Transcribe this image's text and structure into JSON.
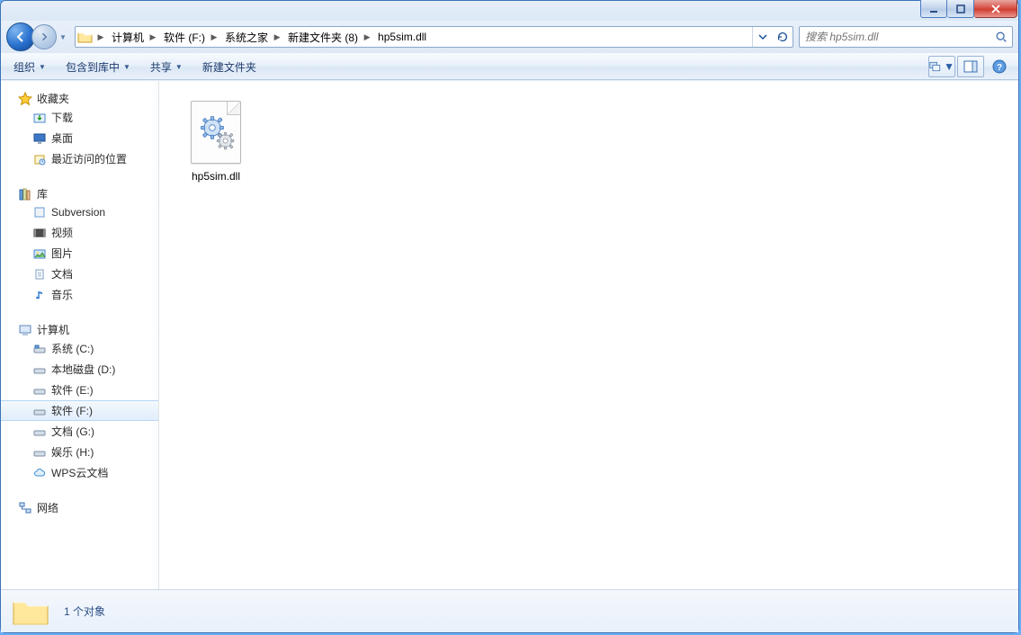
{
  "window_controls": {
    "minimize": "minimize",
    "maximize": "maximize",
    "close": "close"
  },
  "breadcrumb": {
    "items": [
      {
        "label": "计算机"
      },
      {
        "label": "软件 (F:)"
      },
      {
        "label": "系统之家"
      },
      {
        "label": "新建文件夹 (8)"
      },
      {
        "label": "hp5sim.dll"
      }
    ]
  },
  "search": {
    "placeholder": "搜索 hp5sim.dll"
  },
  "toolbar": {
    "organize": "组织",
    "include": "包含到库中",
    "share": "共享",
    "newfolder": "新建文件夹"
  },
  "sidebar": {
    "favorites": {
      "header": "收藏夹",
      "items": [
        {
          "label": "下载",
          "icon": "download-icon"
        },
        {
          "label": "桌面",
          "icon": "desktop-icon"
        },
        {
          "label": "最近访问的位置",
          "icon": "recent-icon"
        }
      ]
    },
    "libraries": {
      "header": "库",
      "items": [
        {
          "label": "Subversion",
          "icon": "library-generic-icon"
        },
        {
          "label": "视频",
          "icon": "video-icon"
        },
        {
          "label": "图片",
          "icon": "pictures-icon"
        },
        {
          "label": "文档",
          "icon": "documents-icon"
        },
        {
          "label": "音乐",
          "icon": "music-icon"
        }
      ]
    },
    "computer": {
      "header": "计算机",
      "items": [
        {
          "label": "系统 (C:)",
          "icon": "system-drive-icon"
        },
        {
          "label": "本地磁盘 (D:)",
          "icon": "drive-icon"
        },
        {
          "label": "软件 (E:)",
          "icon": "drive-icon"
        },
        {
          "label": "软件 (F:)",
          "icon": "drive-icon",
          "selected": true
        },
        {
          "label": "文档 (G:)",
          "icon": "drive-icon"
        },
        {
          "label": "娱乐 (H:)",
          "icon": "drive-icon"
        },
        {
          "label": "WPS云文档",
          "icon": "cloud-icon"
        }
      ]
    },
    "network": {
      "header": "网络"
    }
  },
  "files": {
    "items": [
      {
        "label": "hp5sim.dll",
        "icon": "dll-gear-icon"
      }
    ]
  },
  "statusbar": {
    "text": "1 个对象"
  }
}
